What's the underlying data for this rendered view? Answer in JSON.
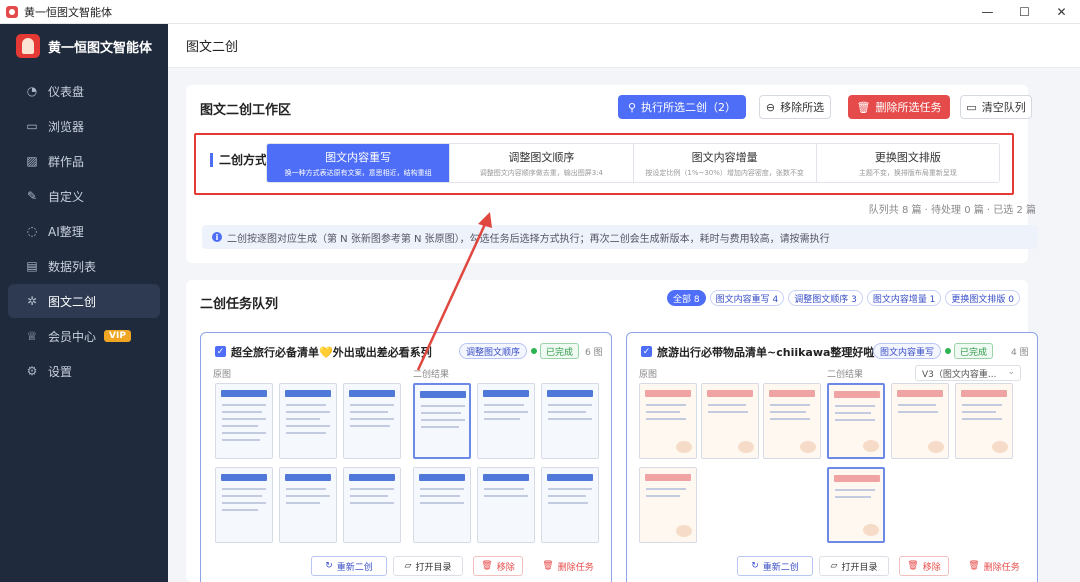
{
  "window": {
    "title": "黄一恒图文智能体",
    "minimize": "—",
    "maximize": "☐",
    "close": "✕"
  },
  "sidebar": {
    "brand": "黄一恒图文智能体",
    "items": [
      {
        "label": "仪表盘",
        "icon": "dashboard-icon",
        "glyph": "◔"
      },
      {
        "label": "浏览器",
        "icon": "monitor-icon",
        "glyph": "▭"
      },
      {
        "label": "群作品",
        "icon": "image-icon",
        "glyph": "▨"
      },
      {
        "label": "自定义",
        "icon": "edit-icon",
        "glyph": "✎"
      },
      {
        "label": "AI整理",
        "icon": "chat-icon",
        "glyph": "◌"
      },
      {
        "label": "数据列表",
        "icon": "document-icon",
        "glyph": "▤"
      },
      {
        "label": "图文二创",
        "icon": "sparkle-icon",
        "glyph": "✲"
      },
      {
        "label": "会员中心",
        "icon": "crown-icon",
        "glyph": "♕",
        "badge": "VIP"
      },
      {
        "label": "设置",
        "icon": "gear-icon",
        "glyph": "⚙"
      }
    ],
    "active_index": 6
  },
  "header": {
    "title": "图文二创"
  },
  "workspace": {
    "title": "图文二创工作区",
    "buttons": {
      "run": "执行所选二创（2）",
      "remove": "移除所选",
      "delete": "删除所选任务",
      "clear": "清空队列"
    },
    "mode_label": "二创方式",
    "modes": [
      {
        "title": "图文内容重写",
        "desc": "换一种方式表达原有文案，意思相近，结构重组",
        "active": true
      },
      {
        "title": "调整图文顺序",
        "desc": "调整图文内容顺序做去重，输出图屏3:4",
        "active": false
      },
      {
        "title": "图文内容增量",
        "desc": "按设定比例（1%~30%）增加内容密度，张数不变",
        "active": false
      },
      {
        "title": "更换图文排版",
        "desc": "主题不变，换排版布局重新呈现",
        "active": false
      }
    ],
    "stats": "队列共 8 篇 · 待处理 0 篇 · 已选 2 篇",
    "info": "二创按逐图对应生成（第 N 张新图参考第 N 张原图），勾选任务后选择方式执行；再次二创会生成新版本，耗时与费用较高，请按需执行"
  },
  "queue": {
    "title": "二创任务队列",
    "filters": [
      {
        "label": "全部 8",
        "active": true
      },
      {
        "label": "图文内容重写 4",
        "active": false
      },
      {
        "label": "调整图文顺序 3",
        "active": false
      },
      {
        "label": "图文内容增量 1",
        "active": false
      },
      {
        "label": "更换图文排版 0",
        "active": false
      }
    ],
    "tasks": [
      {
        "title": "超全旅行必备清单💛外出或出差必看系列",
        "tag": "调整图文顺序",
        "status": "已完成",
        "count": "6 图",
        "original_label": "原图",
        "result_label": "二创结果",
        "actions": {
          "redo": "重新二创",
          "open": "打开目录",
          "remove": "移除"
        },
        "delete": "删除任务"
      },
      {
        "title": "旅游出行必带物品清单~chiikawa整理好啦",
        "tag": "图文内容重写",
        "status": "已完成",
        "count": "4 图",
        "original_label": "原图",
        "result_label": "二创结果",
        "version": "V3（图文内容重...",
        "actions": {
          "redo": "重新二创",
          "open": "打开目录",
          "remove": "移除"
        },
        "delete": "删除任务"
      }
    ]
  },
  "colors": {
    "primary": "#4f6ef7",
    "danger": "#e64b4b",
    "success": "#2fb350",
    "sidebar": "#1f2a3c",
    "highlight": "#e53935"
  }
}
